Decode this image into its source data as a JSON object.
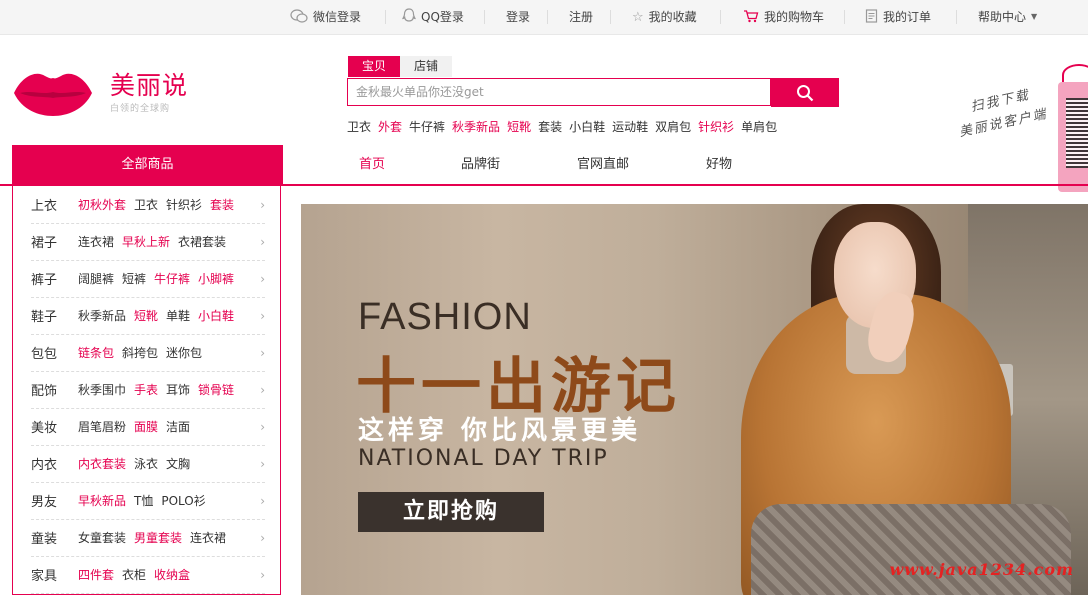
{
  "topbar": {
    "wechat_login": "微信登录",
    "qq_login": "QQ登录",
    "login": "登录",
    "register": "注册",
    "favorites": "我的收藏",
    "cart": "我的购物车",
    "orders": "我的订单",
    "help": "帮助中心"
  },
  "logo": {
    "brand": "美丽说",
    "slogan": "白领的全球购"
  },
  "search": {
    "tabs": [
      "宝贝",
      "店铺"
    ],
    "placeholder": "金秋最火单品你还没get",
    "hotwords": [
      {
        "text": "卫衣",
        "hl": false
      },
      {
        "text": "外套",
        "hl": true
      },
      {
        "text": "牛仔裤",
        "hl": false
      },
      {
        "text": "秋季新品",
        "hl": true
      },
      {
        "text": "短靴",
        "hl": true
      },
      {
        "text": "套装",
        "hl": false
      },
      {
        "text": "小白鞋",
        "hl": false
      },
      {
        "text": "运动鞋",
        "hl": false
      },
      {
        "text": "双肩包",
        "hl": false
      },
      {
        "text": "针织衫",
        "hl": true
      },
      {
        "text": "单肩包",
        "hl": false
      }
    ]
  },
  "qr": {
    "line1": "扫我下载",
    "line2": "美丽说客户端"
  },
  "nav": {
    "all_categories": "全部商品",
    "items": [
      "首页",
      "品牌街",
      "官网直邮",
      "好物"
    ]
  },
  "categories": [
    {
      "name": "上衣",
      "subs": [
        {
          "t": "初秋外套",
          "hl": true
        },
        {
          "t": "卫衣",
          "hl": false
        },
        {
          "t": "针织衫",
          "hl": false
        },
        {
          "t": "套装",
          "hl": true
        }
      ]
    },
    {
      "name": "裙子",
      "subs": [
        {
          "t": "连衣裙",
          "hl": false
        },
        {
          "t": "早秋上新",
          "hl": true
        },
        {
          "t": "衣裙套装",
          "hl": false
        }
      ]
    },
    {
      "name": "裤子",
      "subs": [
        {
          "t": "阔腿裤",
          "hl": false
        },
        {
          "t": "短裤",
          "hl": false
        },
        {
          "t": "牛仔裤",
          "hl": true
        },
        {
          "t": "小脚裤",
          "hl": true
        }
      ]
    },
    {
      "name": "鞋子",
      "subs": [
        {
          "t": "秋季新品",
          "hl": false
        },
        {
          "t": "短靴",
          "hl": true
        },
        {
          "t": "单鞋",
          "hl": false
        },
        {
          "t": "小白鞋",
          "hl": true
        }
      ]
    },
    {
      "name": "包包",
      "subs": [
        {
          "t": "链条包",
          "hl": true
        },
        {
          "t": "斜挎包",
          "hl": false
        },
        {
          "t": "迷你包",
          "hl": false
        }
      ]
    },
    {
      "name": "配饰",
      "subs": [
        {
          "t": "秋季围巾",
          "hl": false
        },
        {
          "t": "手表",
          "hl": true
        },
        {
          "t": "耳饰",
          "hl": false
        },
        {
          "t": "锁骨链",
          "hl": true
        }
      ]
    },
    {
      "name": "美妆",
      "subs": [
        {
          "t": "眉笔眉粉",
          "hl": false
        },
        {
          "t": "面膜",
          "hl": true
        },
        {
          "t": "洁面",
          "hl": false
        }
      ]
    },
    {
      "name": "内衣",
      "subs": [
        {
          "t": "内衣套装",
          "hl": true
        },
        {
          "t": "泳衣",
          "hl": false
        },
        {
          "t": "文胸",
          "hl": false
        }
      ]
    },
    {
      "name": "男友",
      "subs": [
        {
          "t": "早秋新品",
          "hl": true
        },
        {
          "t": "T恤",
          "hl": false
        },
        {
          "t": "POLO衫",
          "hl": false
        }
      ]
    },
    {
      "name": "童装",
      "subs": [
        {
          "t": "女童套装",
          "hl": false
        },
        {
          "t": "男童套装",
          "hl": true
        },
        {
          "t": "连衣裙",
          "hl": false
        }
      ]
    },
    {
      "name": "家具",
      "subs": [
        {
          "t": "四件套",
          "hl": true
        },
        {
          "t": "衣柜",
          "hl": false
        },
        {
          "t": "收纳盒",
          "hl": true
        }
      ]
    }
  ],
  "banner": {
    "title_en": "FASHION",
    "title_cn": "十一出游记",
    "subtitle": "这样穿 你比风景更美",
    "tagline": "NATIONAL DAY TRIP",
    "cta": "立即抢购"
  },
  "watermark": "www.java1234.com",
  "colors": {
    "brand": "#e5004f"
  }
}
